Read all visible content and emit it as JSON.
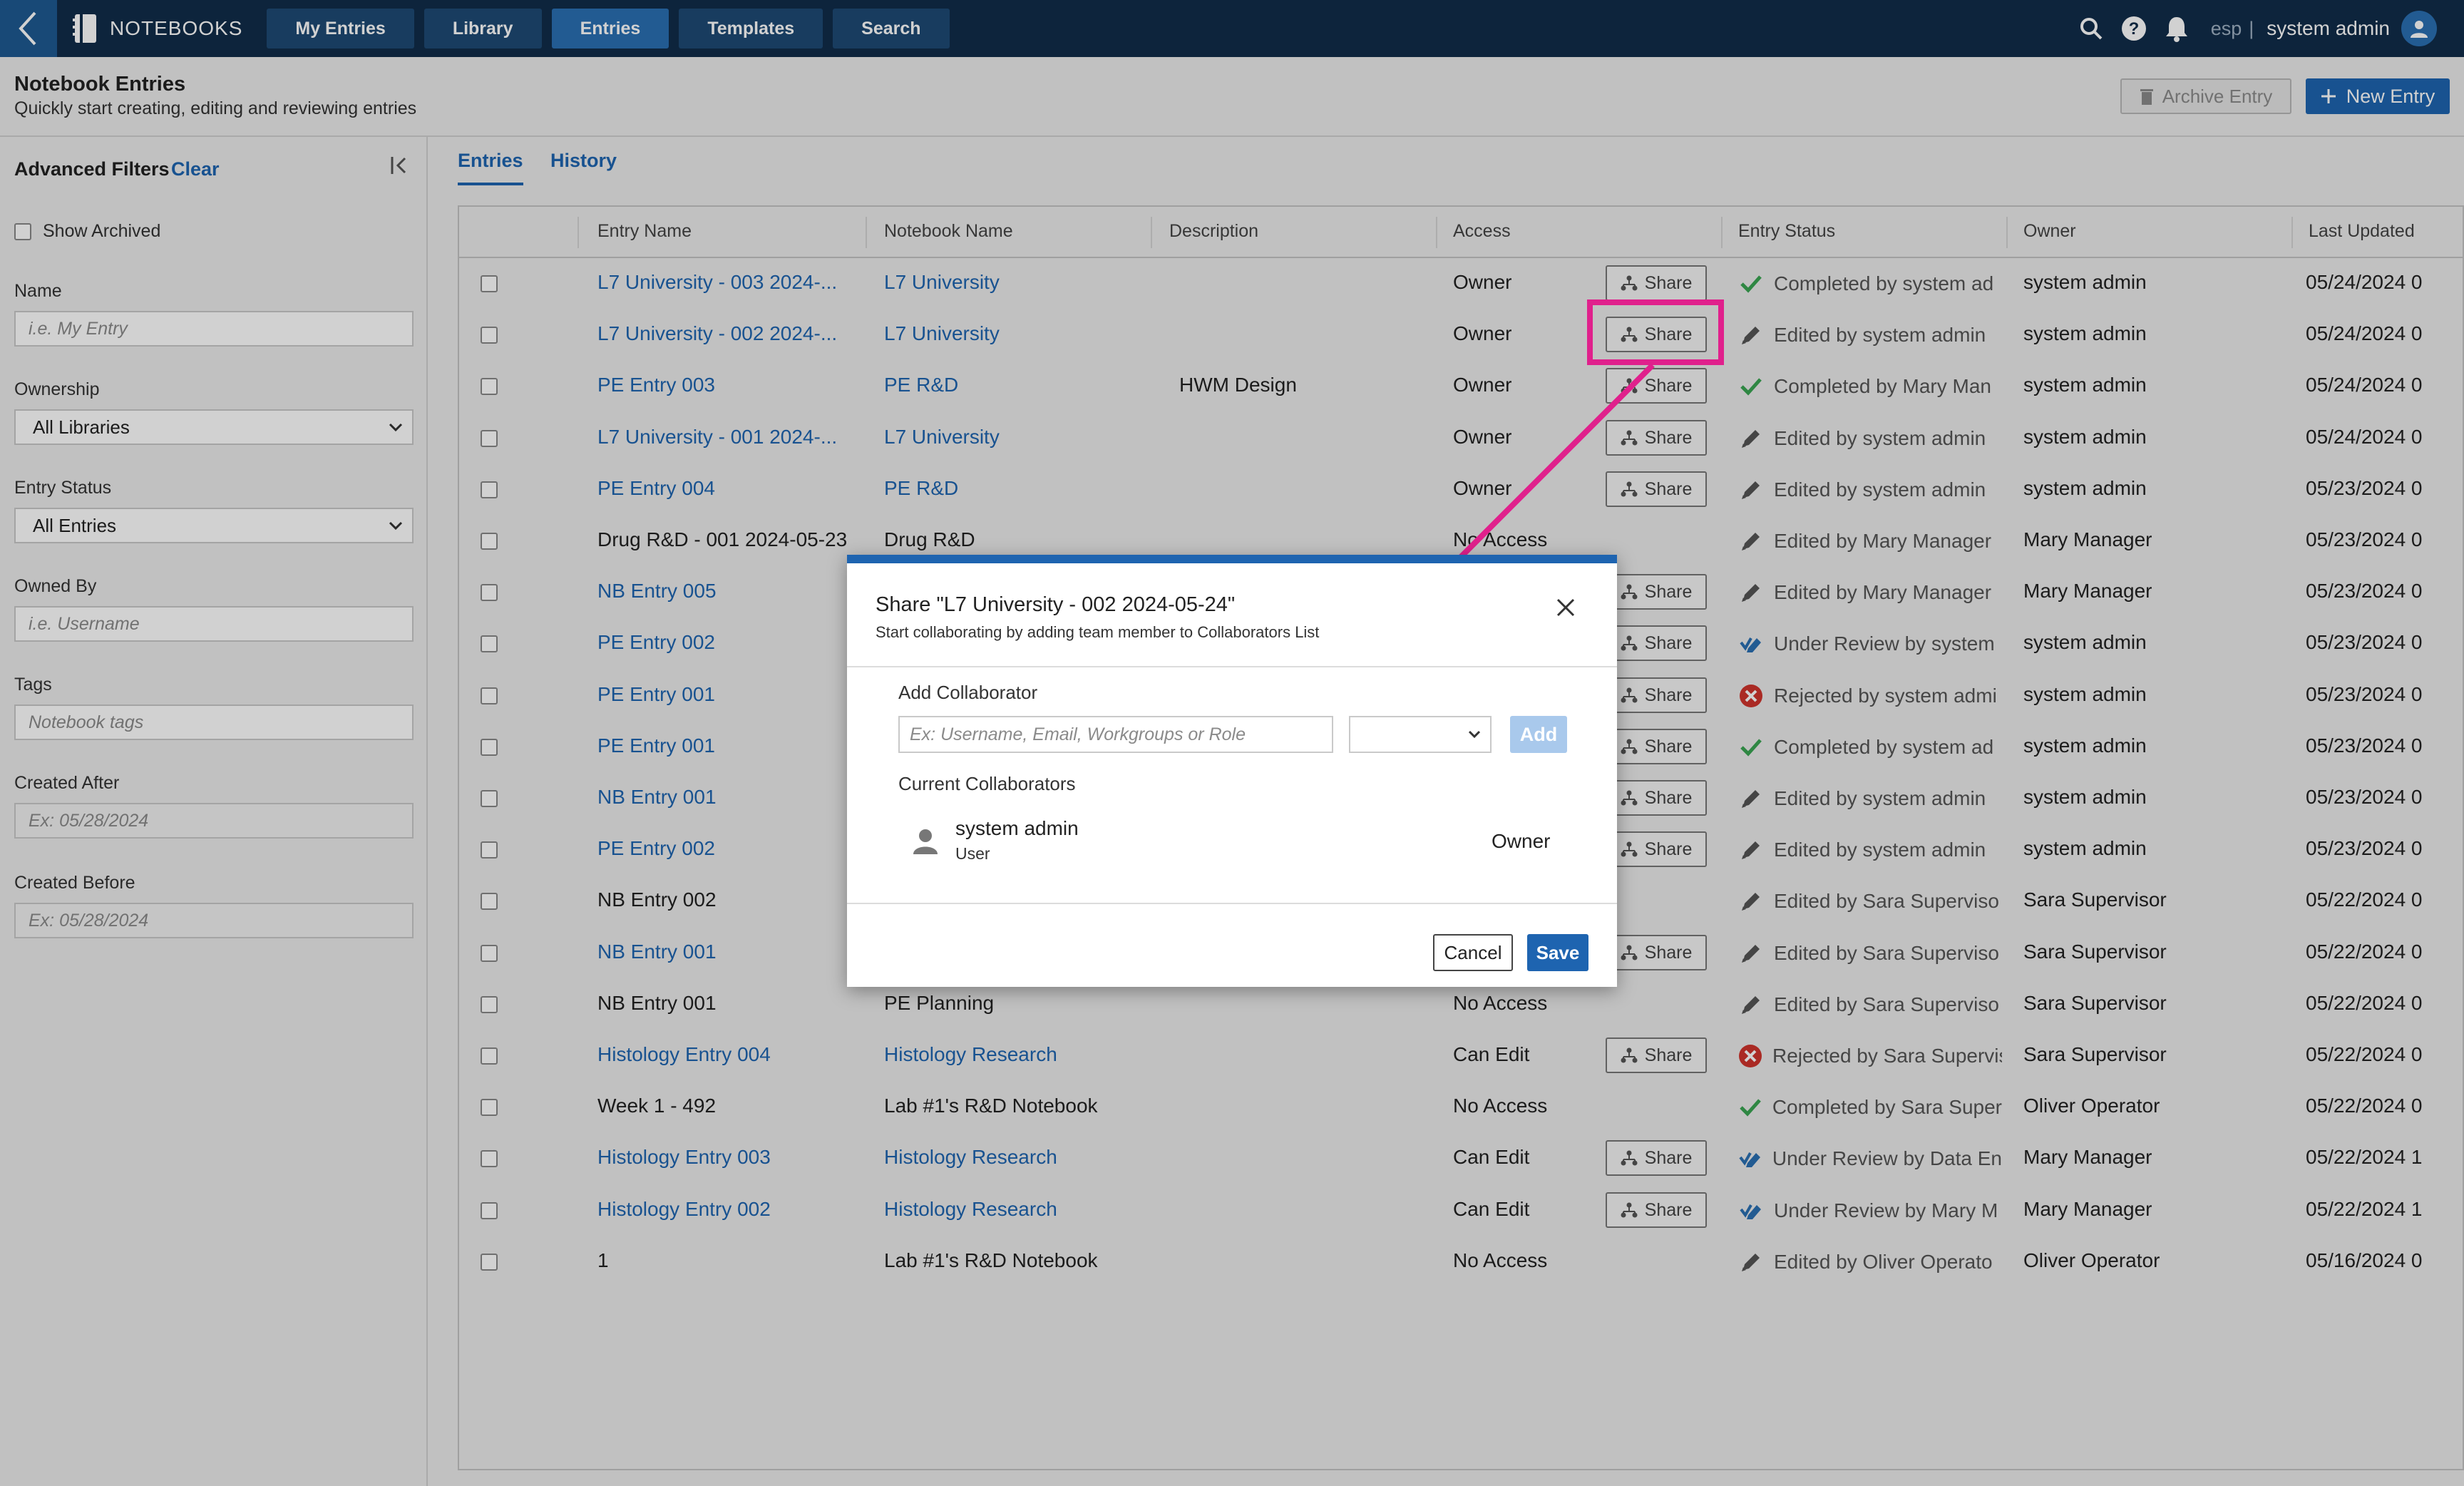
{
  "nav": {
    "brand": "NOTEBOOKS",
    "tabs": [
      {
        "label": "My Entries",
        "active": false
      },
      {
        "label": "Library",
        "active": false
      },
      {
        "label": "Entries",
        "active": true
      },
      {
        "label": "Templates",
        "active": false
      },
      {
        "label": "Search",
        "active": false
      }
    ],
    "lang": "esp",
    "separator": "|",
    "user": "system admin",
    "icons": [
      "search-icon",
      "help-icon",
      "bell-icon",
      "avatar-icon"
    ]
  },
  "header": {
    "title": "Notebook Entries",
    "subtitle": "Quickly start creating, editing and reviewing entries",
    "archive_label": "Archive Entry",
    "new_label": "New Entry"
  },
  "filters": {
    "title": "Advanced Filters",
    "clear": "Clear",
    "show_archived": "Show Archived",
    "name_label": "Name",
    "name_placeholder": "i.e. My Entry",
    "ownership_label": "Ownership",
    "ownership_value": "All Libraries",
    "status_label": "Entry Status",
    "status_value": "All Entries",
    "owned_by_label": "Owned By",
    "owned_by_placeholder": "i.e. Username",
    "tags_label": "Tags",
    "tags_placeholder": "Notebook tags",
    "created_after_label": "Created After",
    "created_after_placeholder": "Ex: 05/28/2024",
    "created_before_label": "Created Before",
    "created_before_placeholder": "Ex: 05/28/2024"
  },
  "tabs": [
    "Entries",
    "History"
  ],
  "table": {
    "columns": [
      "Entry Name",
      "Notebook Name",
      "Description",
      "Access",
      "Entry Status",
      "Owner",
      "Last Updated"
    ],
    "share_label": "Share",
    "rows": [
      {
        "name": "L7 University - 003 2024-...",
        "name_link": true,
        "notebook": "L7 University",
        "nb_link": true,
        "desc": "",
        "access": "Owner",
        "share": true,
        "status_icon": "check",
        "status": "Completed by system ad",
        "owner": "system admin",
        "updated": "05/24/2024 0"
      },
      {
        "name": "L7 University - 002 2024-...",
        "name_link": true,
        "notebook": "L7 University",
        "nb_link": true,
        "desc": "",
        "access": "Owner",
        "share": true,
        "status_icon": "pencil",
        "status": "Edited by system admin",
        "owner": "system admin",
        "updated": "05/24/2024 0"
      },
      {
        "name": "PE Entry 003",
        "name_link": true,
        "notebook": "PE R&D",
        "nb_link": true,
        "desc": "HWM Design",
        "access": "Owner",
        "share": true,
        "status_icon": "check",
        "status": "Completed by Mary Man",
        "owner": "system admin",
        "updated": "05/24/2024 0"
      },
      {
        "name": "L7 University - 001 2024-...",
        "name_link": true,
        "notebook": "L7 University",
        "nb_link": true,
        "desc": "",
        "access": "Owner",
        "share": true,
        "status_icon": "pencil",
        "status": "Edited by system admin",
        "owner": "system admin",
        "updated": "05/24/2024 0"
      },
      {
        "name": "PE Entry 004",
        "name_link": true,
        "notebook": "PE R&D",
        "nb_link": true,
        "desc": "",
        "access": "Owner",
        "share": true,
        "status_icon": "pencil",
        "status": "Edited by system admin",
        "owner": "system admin",
        "updated": "05/23/2024 0"
      },
      {
        "name": "Drug R&D - 001 2024-05-23",
        "name_link": false,
        "notebook": "Drug R&D",
        "nb_link": false,
        "desc": "",
        "access": "No Access",
        "share": false,
        "status_icon": "pencil",
        "status": "Edited by Mary Manager",
        "owner": "Mary Manager",
        "updated": "05/23/2024 0"
      },
      {
        "name": "NB Entry 005",
        "name_link": true,
        "notebook": "",
        "nb_link": false,
        "desc": "",
        "access": "",
        "share": true,
        "status_icon": "pencil",
        "status": "Edited by Mary Manager",
        "owner": "Mary Manager",
        "updated": "05/23/2024 0"
      },
      {
        "name": "PE Entry 002",
        "name_link": true,
        "notebook": "",
        "nb_link": false,
        "desc": "",
        "access": "",
        "share": true,
        "status_icon": "review",
        "status": "Under Review by system",
        "owner": "system admin",
        "updated": "05/23/2024 0"
      },
      {
        "name": "PE Entry 001",
        "name_link": true,
        "notebook": "",
        "nb_link": false,
        "desc": "",
        "access": "",
        "share": true,
        "status_icon": "reject",
        "status": "Rejected by system admi",
        "owner": "system admin",
        "updated": "05/23/2024 0"
      },
      {
        "name": "PE Entry 001",
        "name_link": true,
        "notebook": "",
        "nb_link": false,
        "desc": "",
        "access": "",
        "share": true,
        "status_icon": "check",
        "status": "Completed by system ad",
        "owner": "system admin",
        "updated": "05/23/2024 0"
      },
      {
        "name": "NB Entry 001",
        "name_link": true,
        "notebook": "",
        "nb_link": false,
        "desc": "",
        "access": "",
        "share": true,
        "status_icon": "pencil",
        "status": "Edited by system admin",
        "owner": "system admin",
        "updated": "05/23/2024 0"
      },
      {
        "name": "PE Entry 002",
        "name_link": true,
        "notebook": "",
        "nb_link": false,
        "desc": "",
        "access": "",
        "share": true,
        "status_icon": "pencil",
        "status": "Edited by system admin",
        "owner": "system admin",
        "updated": "05/23/2024 0"
      },
      {
        "name": "NB Entry 002",
        "name_link": false,
        "notebook": "",
        "nb_link": false,
        "desc": "",
        "access": "",
        "share": false,
        "status_icon": "pencil",
        "status": "Edited by Sara Superviso",
        "owner": "Sara Supervisor",
        "updated": "05/22/2024 0"
      },
      {
        "name": "NB Entry 001",
        "name_link": true,
        "notebook": "",
        "nb_link": false,
        "desc": "",
        "access": "",
        "share": true,
        "status_icon": "pencil",
        "status": "Edited by Sara Superviso",
        "owner": "Sara Supervisor",
        "updated": "05/22/2024 0"
      },
      {
        "name": "NB Entry 001",
        "name_link": false,
        "notebook": "PE Planning",
        "nb_link": false,
        "desc": "",
        "access": "No Access",
        "share": false,
        "status_icon": "pencil",
        "status": "Edited by Sara Superviso",
        "owner": "Sara Supervisor",
        "updated": "05/22/2024 0"
      },
      {
        "name": "Histology Entry 004",
        "name_link": true,
        "notebook": "Histology Research",
        "nb_link": true,
        "desc": "",
        "access": "Can Edit",
        "share": true,
        "status_icon": "reject",
        "status": "Rejected by Sara Supervis",
        "owner": "Sara Supervisor",
        "updated": "05/22/2024 0"
      },
      {
        "name": "Week 1 - 492",
        "name_link": false,
        "notebook": "Lab #1's R&D Notebook",
        "nb_link": false,
        "desc": "",
        "access": "No Access",
        "share": false,
        "status_icon": "check",
        "status": "Completed by Sara Super",
        "owner": "Oliver Operator",
        "updated": "05/22/2024 0"
      },
      {
        "name": "Histology Entry 003",
        "name_link": true,
        "notebook": "Histology Research",
        "nb_link": true,
        "desc": "",
        "access": "Can Edit",
        "share": true,
        "status_icon": "review",
        "status": "Under Review by Data En",
        "owner": "Mary Manager",
        "updated": "05/22/2024 1"
      },
      {
        "name": "Histology Entry 002",
        "name_link": true,
        "notebook": "Histology Research",
        "nb_link": true,
        "desc": "",
        "access": "Can Edit",
        "share": true,
        "status_icon": "review",
        "status": "Under Review by Mary M",
        "owner": "Mary Manager",
        "updated": "05/22/2024 1"
      },
      {
        "name": "1",
        "name_link": false,
        "notebook": "Lab #1's R&D Notebook",
        "nb_link": false,
        "desc": "",
        "access": "No Access",
        "share": false,
        "status_icon": "pencil",
        "status": "Edited by Oliver Operato",
        "owner": "Oliver Operator",
        "updated": "05/16/2024 0"
      }
    ]
  },
  "modal": {
    "title": "Share \"L7 University - 002 2024-05-24\"",
    "subtitle": "Start collaborating by adding team member to Collaborators List",
    "add_label": "Add Collaborator",
    "input_placeholder": "Ex: Username, Email, Workgroups or Role",
    "add_button": "Add",
    "current_label": "Current Collaborators",
    "collaborator": {
      "name": "system admin",
      "type": "User",
      "role": "Owner"
    },
    "cancel": "Cancel",
    "save": "Save"
  },
  "colors": {
    "nav_bg": "#102d4a",
    "accent": "#1e64b0",
    "highlight": "#e0208c",
    "check": "#3aa552",
    "reject": "#d0342c"
  }
}
